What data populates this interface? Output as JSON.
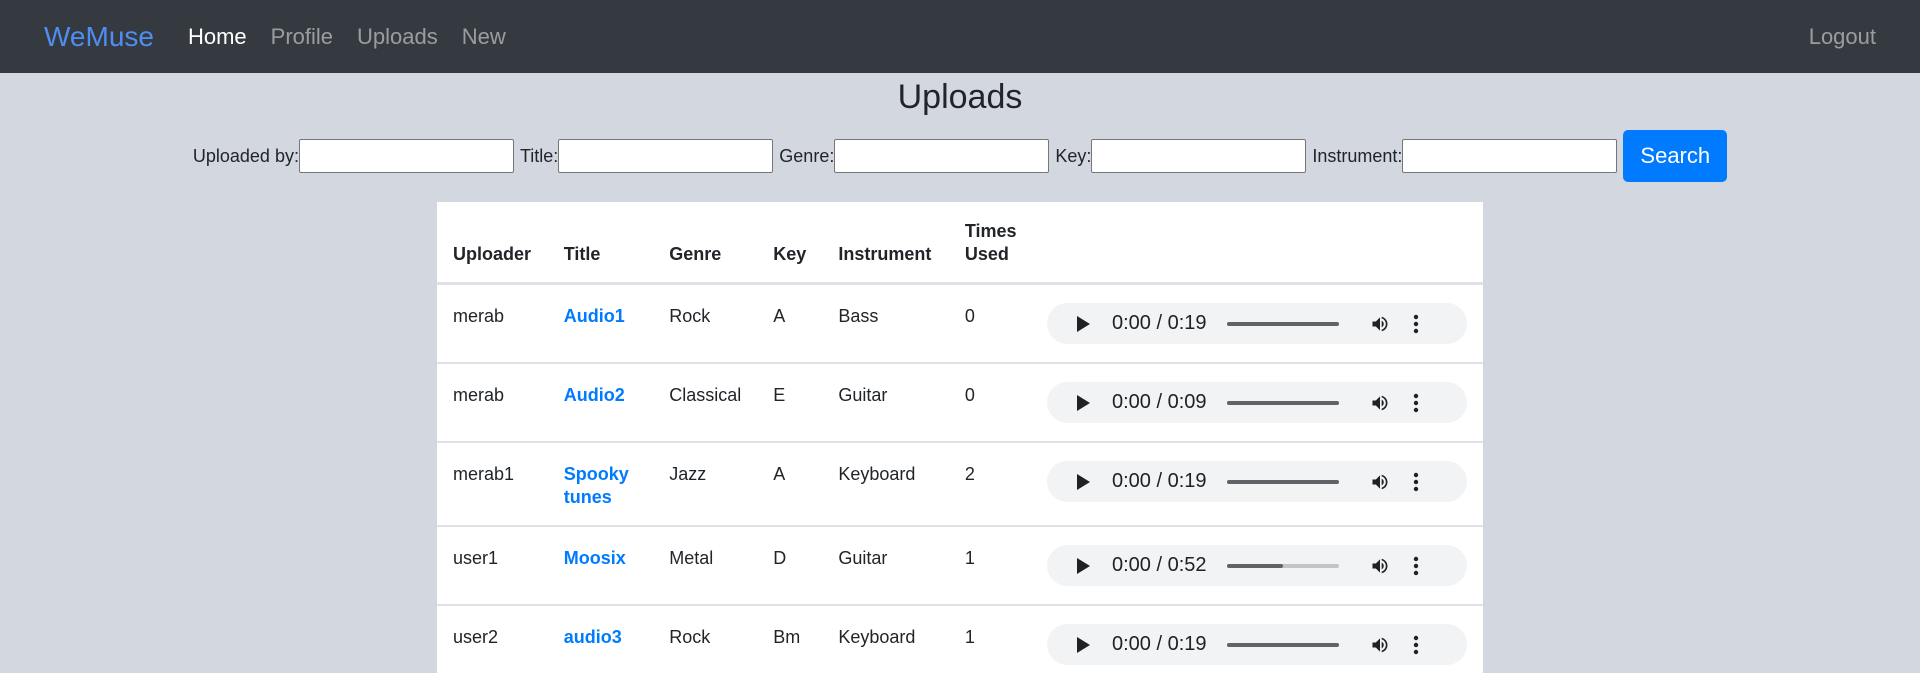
{
  "nav": {
    "brand": "WeMuse",
    "links": [
      "Home",
      "Profile",
      "Uploads",
      "New"
    ],
    "logout": "Logout"
  },
  "page_title": "Uploads",
  "search": {
    "uploaded_by_label": "Uploaded by:",
    "title_label": "Title:",
    "genre_label": "Genre:",
    "key_label": "Key:",
    "instrument_label": "Instrument:",
    "button": "Search"
  },
  "table": {
    "headers": [
      "Uploader",
      "Title",
      "Genre",
      "Key",
      "Instrument",
      "Times Used"
    ],
    "rows": [
      {
        "uploader": "merab",
        "title": "Audio1",
        "genre": "Rock",
        "key": "A",
        "instrument": "Bass",
        "times_used": "0",
        "time": "0:00 / 0:19",
        "progress": 1.0
      },
      {
        "uploader": "merab",
        "title": "Audio2",
        "genre": "Classical",
        "key": "E",
        "instrument": "Guitar",
        "times_used": "0",
        "time": "0:00 / 0:09",
        "progress": 1.0
      },
      {
        "uploader": "merab1",
        "title": "Spooky tunes",
        "genre": "Jazz",
        "key": "A",
        "instrument": "Keyboard",
        "times_used": "2",
        "time": "0:00 / 0:19",
        "progress": 1.0
      },
      {
        "uploader": "user1",
        "title": "Moosix",
        "genre": "Metal",
        "key": "D",
        "instrument": "Guitar",
        "times_used": "1",
        "time": "0:00 / 0:52",
        "progress": 0.5
      },
      {
        "uploader": "user2",
        "title": "audio3",
        "genre": "Rock",
        "key": "Bm",
        "instrument": "Keyboard",
        "times_used": "1",
        "time": "0:00 / 0:19",
        "progress": 1.0
      }
    ]
  },
  "icons": {
    "play": "play-icon",
    "volume": "volume-icon",
    "more": "more-vert-icon"
  },
  "colors": {
    "navbar_bg": "#343a40",
    "brand": "#4f8df0",
    "accent": "#007bff",
    "page_bg": "#d3d7df"
  }
}
